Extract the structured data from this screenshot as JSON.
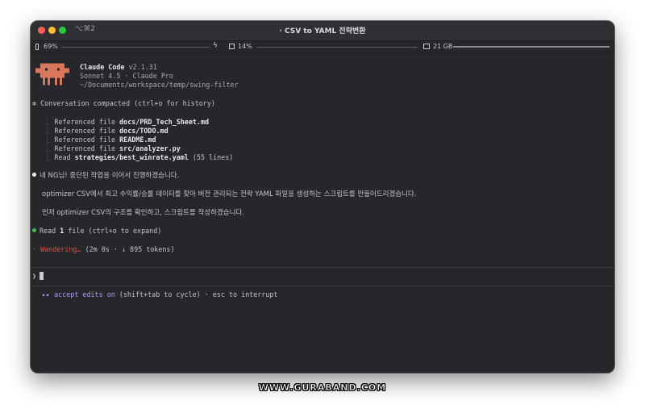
{
  "window": {
    "shortcut": "⌥⌘2",
    "title_prefix": "·",
    "title": "CSV to YAML 전략변환"
  },
  "status": {
    "battery": "69%",
    "cpu": "14%",
    "disk": "21 GB"
  },
  "banner": {
    "app_name": "Claude Code",
    "version": "v2.1.31",
    "model": "Sonnet 4.5 · Claude Pro",
    "cwd": "~/Documents/workspace/temp/swing-filter"
  },
  "compacted": {
    "marker": "✻",
    "text": "Conversation compacted (ctrl+o for history)"
  },
  "references": [
    {
      "branch": "⎿",
      "prefix": "Referenced file",
      "target": "docs/PRD_Tech_Sheet.md",
      "suffix": ""
    },
    {
      "branch": "⎿",
      "prefix": "Referenced file",
      "target": "docs/TODO.md",
      "suffix": ""
    },
    {
      "branch": "⎿",
      "prefix": "Referenced file",
      "target": "README.md",
      "suffix": ""
    },
    {
      "branch": "⎿",
      "prefix": "Referenced file",
      "target": "src/analyzer.py",
      "suffix": ""
    },
    {
      "branch": "⎿",
      "prefix": "Read",
      "target": "strategies/best_winrate.yaml",
      "suffix": "(55 lines)"
    }
  ],
  "messages": [
    "네 NG님! 중단된 작업을 이어서 진행하겠습니다.",
    "optimizer CSV에서 최고 수익률/승률 데이터를 찾아 버전 관리되는 전략 YAML 파일을 생성하는 스크립트를 만들어드리겠습니다.",
    "먼저 optimizer CSV의 구조를 확인하고, 스크립트를 작성하겠습니다."
  ],
  "tool_call": {
    "prefix": "Read",
    "count": "1",
    "suffix": "file (ctrl+o to expand)"
  },
  "progress": {
    "marker": "·",
    "verb": "Wandering…",
    "detail": "(2m 0s · ↓ 895 tokens)"
  },
  "prompt": {
    "symbol": "❯",
    "value": ""
  },
  "footer": {
    "arrows": "▸▸",
    "mode": "accept edits on",
    "hint": "(shift+tab to cycle) · esc to interrupt"
  },
  "watermark": "WWW.GURABAND.COM",
  "colors": {
    "terminal_bg": "#26272b",
    "mascot": "#d9775c",
    "progress": "#d9534f",
    "accept_edits": "#a99cf4",
    "bullet_white": "#ffffff",
    "bullet_green": "#3fb950"
  },
  "icons": [
    "battery-icon",
    "bolt-icon",
    "cpu-icon",
    "disk-icon",
    "prompt-chevron-icon"
  ]
}
